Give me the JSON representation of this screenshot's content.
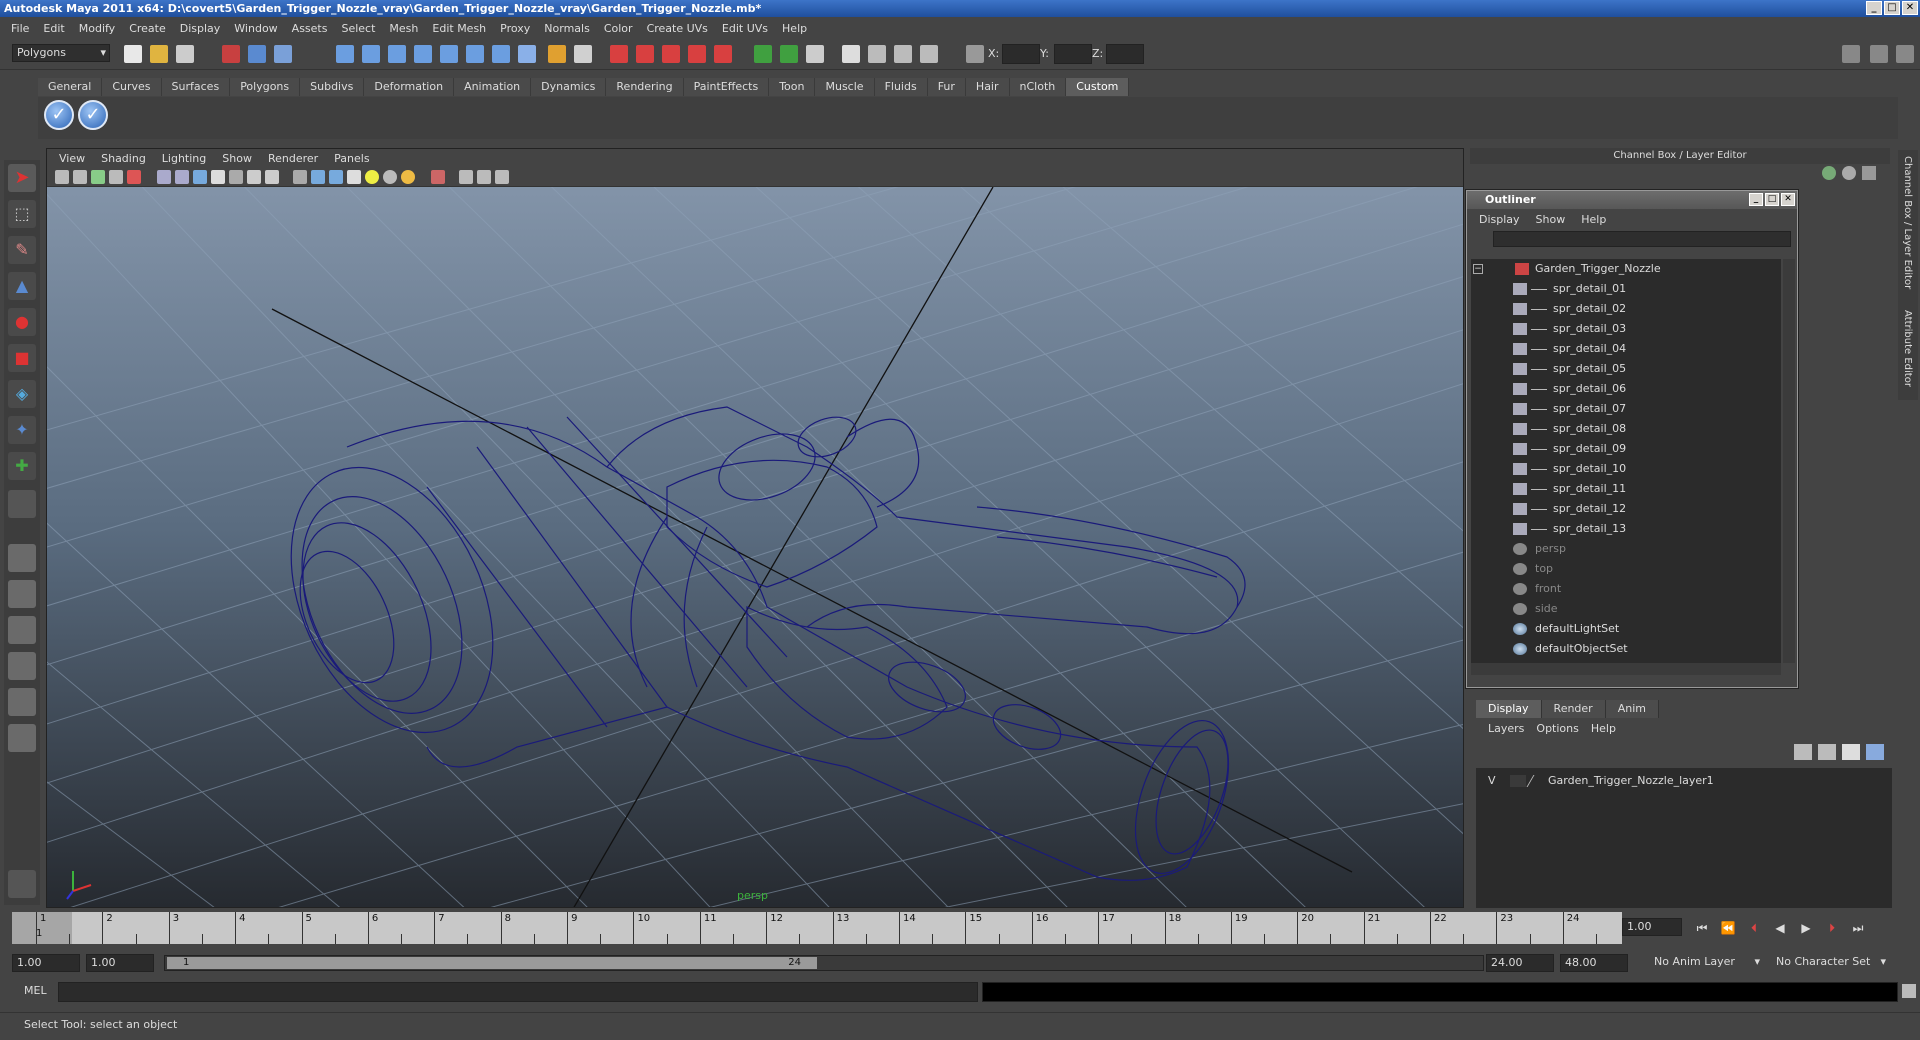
{
  "window": {
    "title": "Autodesk Maya 2011 x64: D:\\covert5\\Garden_Trigger_Nozzle_vray\\Garden_Trigger_Nozzle_vray\\Garden_Trigger_Nozzle.mb*",
    "min": "_",
    "max": "□",
    "close": "✕"
  },
  "menubar": [
    "File",
    "Edit",
    "Modify",
    "Create",
    "Display",
    "Window",
    "Assets",
    "Select",
    "Mesh",
    "Edit Mesh",
    "Proxy",
    "Normals",
    "Color",
    "Create UVs",
    "Edit UVs",
    "Help"
  ],
  "toolbar": {
    "mode": "Polygons",
    "x_label": "X:",
    "y_label": "Y:",
    "z_label": "Z:"
  },
  "shelf_tabs": [
    "General",
    "Curves",
    "Surfaces",
    "Polygons",
    "Subdivs",
    "Deformation",
    "Animation",
    "Dynamics",
    "Rendering",
    "PaintEffects",
    "Toon",
    "Muscle",
    "Fluids",
    "Fur",
    "Hair",
    "nCloth",
    "Custom"
  ],
  "shelf_active": "Custom",
  "viewport": {
    "menu": [
      "View",
      "Shading",
      "Lighting",
      "Show",
      "Renderer",
      "Panels"
    ],
    "camera_label": "persp"
  },
  "right_panel": {
    "header": "Channel Box / Layer Editor",
    "side_tab_1": "Channel Box / Layer Editor",
    "side_tab_2": "Attribute Editor"
  },
  "outliner": {
    "title": "Outliner",
    "menu": [
      "Display",
      "Show",
      "Help"
    ],
    "root": "Garden_Trigger_Nozzle",
    "children": [
      "spr_detail_01",
      "spr_detail_02",
      "spr_detail_03",
      "spr_detail_04",
      "spr_detail_05",
      "spr_detail_06",
      "spr_detail_07",
      "spr_detail_08",
      "spr_detail_09",
      "spr_detail_10",
      "spr_detail_11",
      "spr_detail_12",
      "spr_detail_13"
    ],
    "cameras": [
      "persp",
      "top",
      "front",
      "side"
    ],
    "sets": [
      "defaultLightSet",
      "defaultObjectSet"
    ]
  },
  "layer_editor": {
    "tabs": [
      "Display",
      "Render",
      "Anim"
    ],
    "active_tab": "Display",
    "menu": [
      "Layers",
      "Options",
      "Help"
    ],
    "layers": [
      {
        "visible": "V",
        "name": "Garden_Trigger_Nozzle_layer1"
      }
    ]
  },
  "timeline": {
    "ticks": [
      "1",
      "2",
      "3",
      "4",
      "5",
      "6",
      "7",
      "8",
      "9",
      "10",
      "11",
      "12",
      "13",
      "14",
      "15",
      "16",
      "17",
      "18",
      "19",
      "20",
      "21",
      "22",
      "23",
      "24"
    ],
    "current_frame_marker": "1",
    "current_time": "1.00"
  },
  "range": {
    "start": "1.00",
    "playback_start": "1.00",
    "inner_start": "1",
    "inner_end": "24",
    "playback_end": "24.00",
    "end": "48.00",
    "anim_layer": "No Anim Layer",
    "character_set": "No Character Set"
  },
  "command_line": {
    "label": "MEL"
  },
  "status": "Select Tool: select an object",
  "colors": {
    "wireframe": "#1a1a7a",
    "title_bar": "#2a5caa"
  }
}
